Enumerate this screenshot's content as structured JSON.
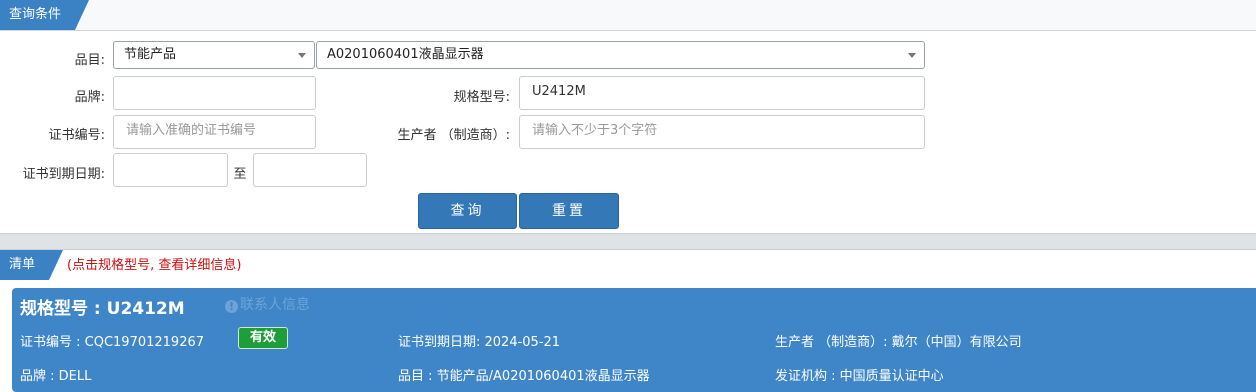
{
  "query_panel": {
    "tab_label": "查询条件",
    "category_label": "品目:",
    "category_value": "节能产品",
    "subcategory_value": "A0201060401液晶显示器",
    "brand_label": "品牌:",
    "brand_value": "",
    "model_label": "规格型号:",
    "model_value": "U2412M",
    "cert_no_label": "证书编号:",
    "cert_no_placeholder": "请输入准确的证书编号",
    "maker_label": "生产者 （制造商）:",
    "maker_placeholder": "请输入不少于3个字符",
    "expiry_label": "证书到期日期:",
    "expiry_to": "至",
    "search_button": "查询",
    "reset_button": "重置"
  },
  "list_panel": {
    "tab_label": "清单",
    "hint": "(点击规格型号, 查看详细信息)",
    "result": {
      "title": "规格型号 : U2412M",
      "contact_link": "联系人信息",
      "cert_no": "证书编号 : CQC19701219267",
      "status": "有效",
      "expiry": "证书到期日期: 2024-05-21",
      "maker": "生产者 （制造商）: 戴尔（中国）有限公司",
      "brand": "品牌 : DELL",
      "category": "品目 : 节能产品/A0201060401液晶显示器",
      "issuer": "发证机构 : 中国质量认证中心"
    }
  }
}
